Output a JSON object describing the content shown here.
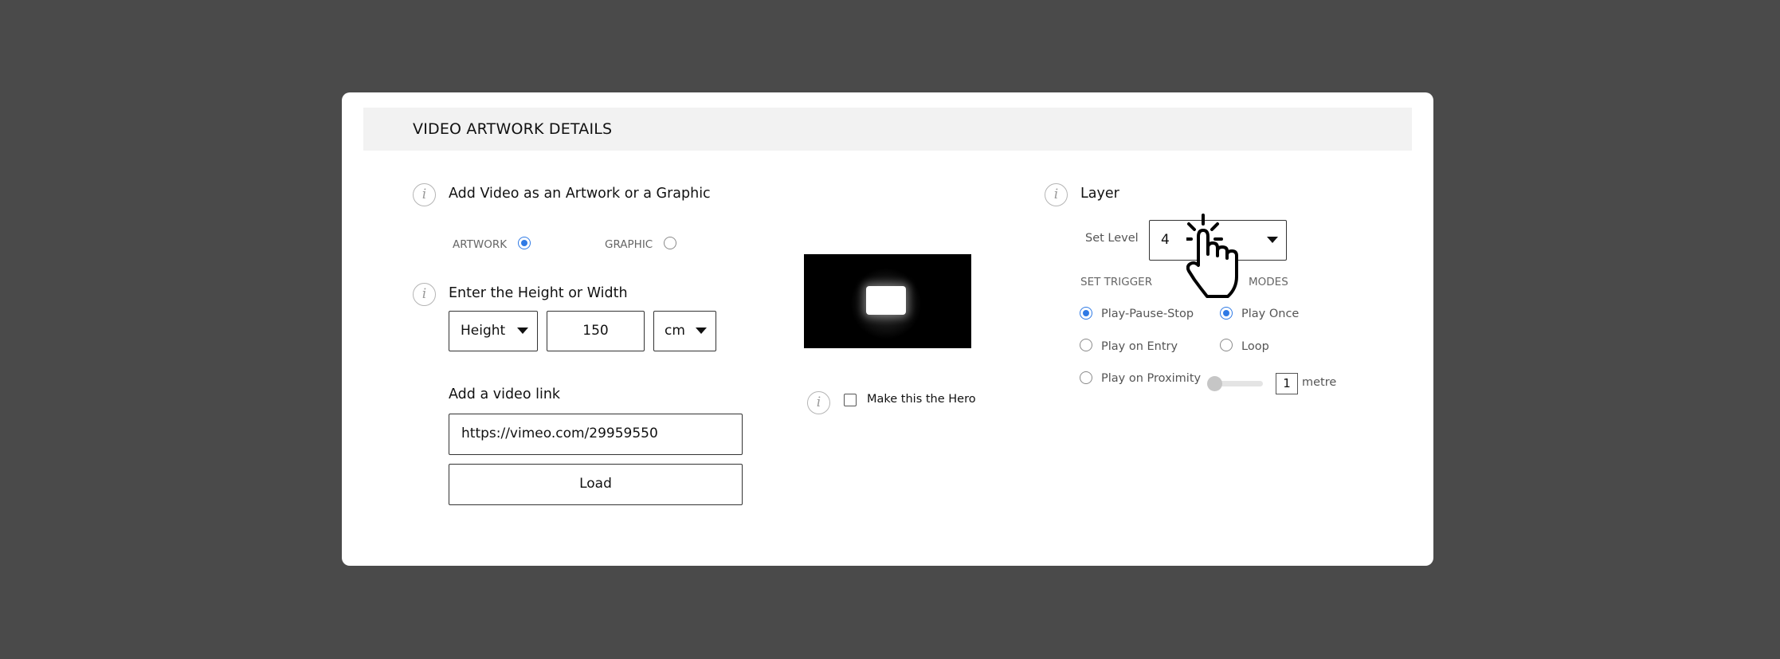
{
  "header": {
    "title": "VIDEO ARTWORK DETAILS"
  },
  "artwork_type": {
    "label": "Add Video as an Artwork or a Graphic",
    "options": [
      {
        "label": "ARTWORK",
        "selected": true
      },
      {
        "label": "GRAPHIC",
        "selected": false
      }
    ]
  },
  "dimensions": {
    "label": "Enter the Height or Width",
    "dimension_select": "Height",
    "value": "150",
    "unit_select": "cm"
  },
  "video_link": {
    "label": "Add a video link",
    "value": "https://vimeo.com/29959550",
    "load_label": "Load"
  },
  "hero": {
    "label": "Make this the Hero",
    "checked": false
  },
  "layer": {
    "label": "Layer",
    "set_level_label": "Set Level",
    "level_value": "4"
  },
  "trigger": {
    "label": "SET TRIGGER",
    "options": [
      {
        "label": "Play-Pause-Stop",
        "selected": true
      },
      {
        "label": "Play on Entry",
        "selected": false
      },
      {
        "label": "Play on Proximity",
        "selected": false
      }
    ]
  },
  "modes": {
    "label": "MODES",
    "options": [
      {
        "label": "Play Once",
        "selected": true
      },
      {
        "label": "Loop",
        "selected": false
      }
    ]
  },
  "proximity": {
    "value": "1",
    "unit": "metre",
    "slider_fraction": 0.0
  },
  "colors": {
    "accent": "#2f7ae5",
    "background": "#4a4a4a",
    "header_bg": "#f2f2f2"
  },
  "icons": [
    "info-icon",
    "caret-down-icon",
    "hand-pointer-cursor-icon"
  ]
}
